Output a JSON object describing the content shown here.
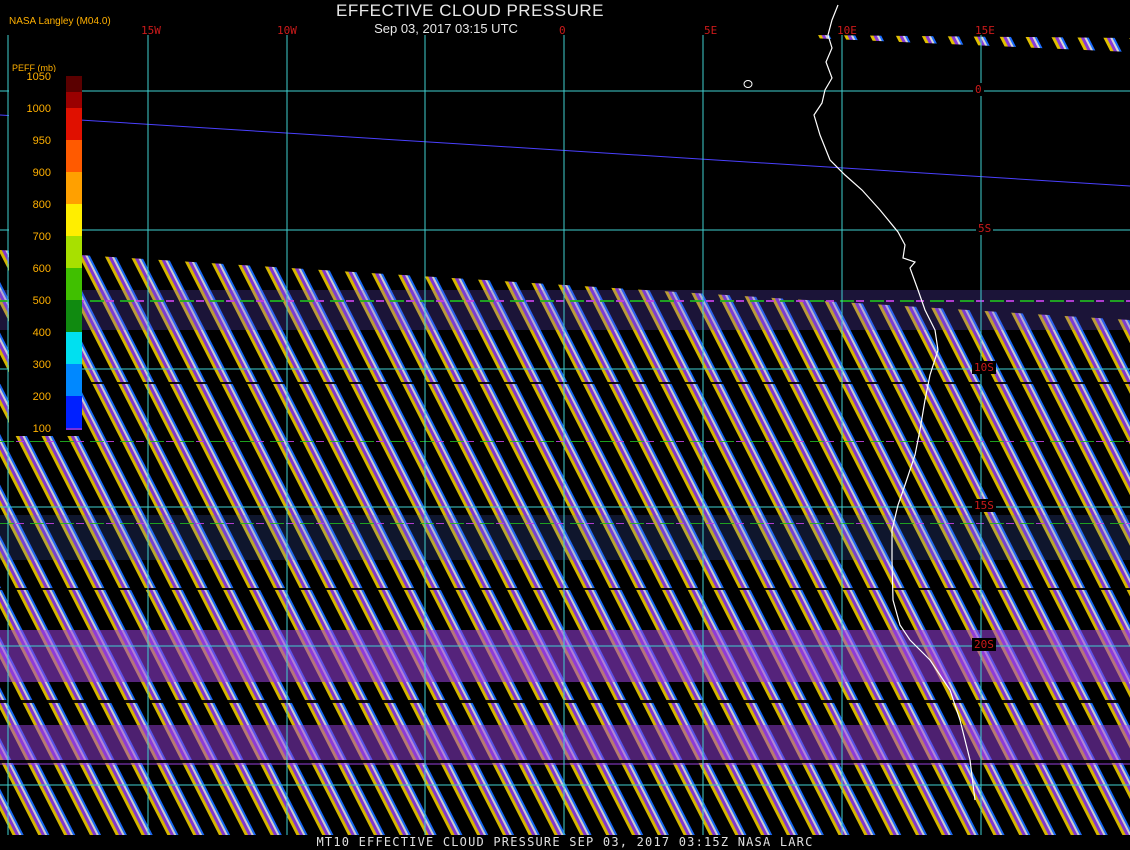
{
  "header": {
    "title": "EFFECTIVE CLOUD PRESSURE",
    "subtitle": "Sep 03, 2017 03:15 UTC",
    "institution": "NASA Langley (M04.0)"
  },
  "footer": {
    "text": "MT10  EFFECTIVE CLOUD PRESSURE   SEP 03, 2017 03:15Z   NASA LARC"
  },
  "map": {
    "longitude_labels": [
      "15W",
      "10W",
      "0",
      "5E",
      "10E",
      "15E"
    ],
    "latitude_labels": [
      "0",
      "5S",
      "10S",
      "15S",
      "20S"
    ],
    "grid_color": "#40d0d0",
    "coast_color": "#ffffff",
    "label_color": "#cc1a1a",
    "swath_colors": [
      "#e0c000",
      "#8a3ad8",
      "#ffffff",
      "#1a6cff",
      "#20b020",
      "#ff8a00"
    ]
  },
  "colorbar": {
    "title": "PEFF (mb)",
    "labels": [
      "1050",
      "1000",
      "950",
      "900",
      "800",
      "700",
      "600",
      "500",
      "400",
      "300",
      "200",
      "100"
    ],
    "colors": [
      "#5a0000",
      "#9a0000",
      "#e01000",
      "#ff5a00",
      "#ffa000",
      "#ffee00",
      "#a8e000",
      "#40c000",
      "#108a10",
      "#00e0f0",
      "#0088ff",
      "#0020ff",
      "#7a30d8"
    ]
  }
}
